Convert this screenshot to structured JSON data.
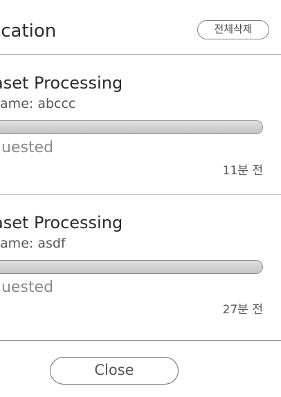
{
  "header": {
    "title": "ication",
    "delete_all_label": "전체삭제"
  },
  "notifications": [
    {
      "title": "aset Processing",
      "subtitle": "name: abccc",
      "progress": 1.0,
      "status": "quested",
      "time": "11분 전"
    },
    {
      "title": "aset Processing",
      "subtitle": "name: asdf",
      "progress": 1.0,
      "status": "quested",
      "time": "27분 전"
    }
  ],
  "footer": {
    "close_label": "Close"
  }
}
